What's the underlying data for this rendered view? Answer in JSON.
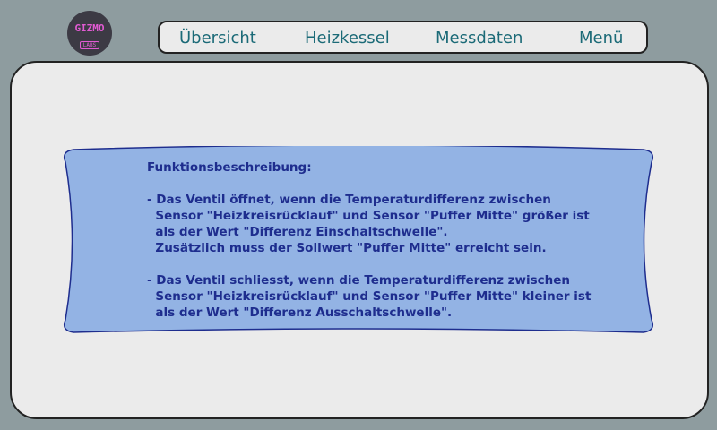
{
  "logo": {
    "line1": "GIZMO",
    "line2": "LABS"
  },
  "nav": {
    "tabs": [
      {
        "label": "Übersicht"
      },
      {
        "label": "Heizkessel"
      },
      {
        "label": "Messdaten"
      },
      {
        "label": "Menü"
      }
    ]
  },
  "info": {
    "heading": "Funktionsbeschreibung:",
    "open_lines": [
      "- Das Ventil öffnet, wenn die Temperaturdifferenz zwischen",
      "  Sensor \"Heizkreisrücklauf\" und Sensor \"Puffer Mitte\" größer ist",
      "  als der Wert \"Differenz Einschaltschwelle\".",
      "  Zusätzlich muss der Sollwert \"Puffer Mitte\" erreicht sein."
    ],
    "close_lines": [
      "- Das Ventil schliesst, wenn die Temperaturdifferenz zwischen",
      "  Sensor \"Heizkreisrücklauf\" und Sensor \"Puffer Mitte\" kleiner ist",
      "  als der Wert \"Differenz Ausschaltschwelle\"."
    ]
  },
  "colors": {
    "background": "#8e9c9f",
    "panel": "#ebebeb",
    "scroll_fill": "#93b3e4",
    "scroll_border": "#1e2d8e",
    "nav_text": "#1b6a77",
    "logo_bg": "#3c3a44",
    "logo_text": "#e25bd3"
  }
}
